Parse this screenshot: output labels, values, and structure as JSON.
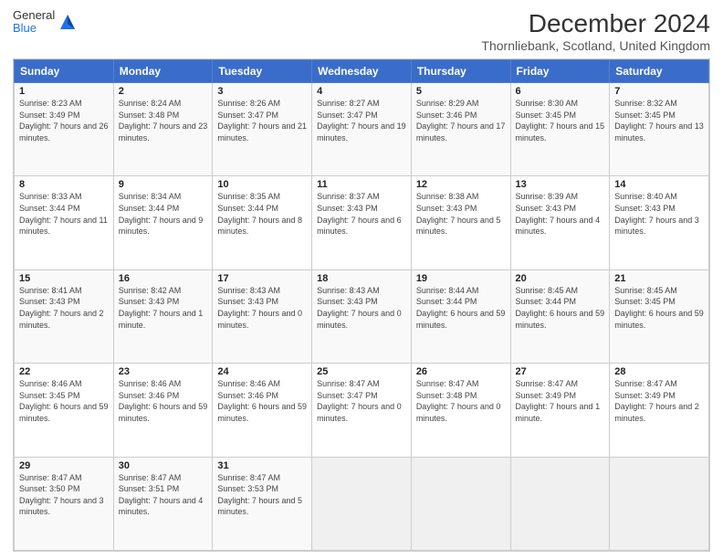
{
  "header": {
    "logo_general": "General",
    "logo_blue": "Blue",
    "title": "December 2024",
    "location": "Thornliebank, Scotland, United Kingdom"
  },
  "weekdays": [
    "Sunday",
    "Monday",
    "Tuesday",
    "Wednesday",
    "Thursday",
    "Friday",
    "Saturday"
  ],
  "weeks": [
    [
      {
        "day": "1",
        "sunrise": "Sunrise: 8:23 AM",
        "sunset": "Sunset: 3:49 PM",
        "daylight": "Daylight: 7 hours and 26 minutes."
      },
      {
        "day": "2",
        "sunrise": "Sunrise: 8:24 AM",
        "sunset": "Sunset: 3:48 PM",
        "daylight": "Daylight: 7 hours and 23 minutes."
      },
      {
        "day": "3",
        "sunrise": "Sunrise: 8:26 AM",
        "sunset": "Sunset: 3:47 PM",
        "daylight": "Daylight: 7 hours and 21 minutes."
      },
      {
        "day": "4",
        "sunrise": "Sunrise: 8:27 AM",
        "sunset": "Sunset: 3:47 PM",
        "daylight": "Daylight: 7 hours and 19 minutes."
      },
      {
        "day": "5",
        "sunrise": "Sunrise: 8:29 AM",
        "sunset": "Sunset: 3:46 PM",
        "daylight": "Daylight: 7 hours and 17 minutes."
      },
      {
        "day": "6",
        "sunrise": "Sunrise: 8:30 AM",
        "sunset": "Sunset: 3:45 PM",
        "daylight": "Daylight: 7 hours and 15 minutes."
      },
      {
        "day": "7",
        "sunrise": "Sunrise: 8:32 AM",
        "sunset": "Sunset: 3:45 PM",
        "daylight": "Daylight: 7 hours and 13 minutes."
      }
    ],
    [
      {
        "day": "8",
        "sunrise": "Sunrise: 8:33 AM",
        "sunset": "Sunset: 3:44 PM",
        "daylight": "Daylight: 7 hours and 11 minutes."
      },
      {
        "day": "9",
        "sunrise": "Sunrise: 8:34 AM",
        "sunset": "Sunset: 3:44 PM",
        "daylight": "Daylight: 7 hours and 9 minutes."
      },
      {
        "day": "10",
        "sunrise": "Sunrise: 8:35 AM",
        "sunset": "Sunset: 3:44 PM",
        "daylight": "Daylight: 7 hours and 8 minutes."
      },
      {
        "day": "11",
        "sunrise": "Sunrise: 8:37 AM",
        "sunset": "Sunset: 3:43 PM",
        "daylight": "Daylight: 7 hours and 6 minutes."
      },
      {
        "day": "12",
        "sunrise": "Sunrise: 8:38 AM",
        "sunset": "Sunset: 3:43 PM",
        "daylight": "Daylight: 7 hours and 5 minutes."
      },
      {
        "day": "13",
        "sunrise": "Sunrise: 8:39 AM",
        "sunset": "Sunset: 3:43 PM",
        "daylight": "Daylight: 7 hours and 4 minutes."
      },
      {
        "day": "14",
        "sunrise": "Sunrise: 8:40 AM",
        "sunset": "Sunset: 3:43 PM",
        "daylight": "Daylight: 7 hours and 3 minutes."
      }
    ],
    [
      {
        "day": "15",
        "sunrise": "Sunrise: 8:41 AM",
        "sunset": "Sunset: 3:43 PM",
        "daylight": "Daylight: 7 hours and 2 minutes."
      },
      {
        "day": "16",
        "sunrise": "Sunrise: 8:42 AM",
        "sunset": "Sunset: 3:43 PM",
        "daylight": "Daylight: 7 hours and 1 minute."
      },
      {
        "day": "17",
        "sunrise": "Sunrise: 8:43 AM",
        "sunset": "Sunset: 3:43 PM",
        "daylight": "Daylight: 7 hours and 0 minutes."
      },
      {
        "day": "18",
        "sunrise": "Sunrise: 8:43 AM",
        "sunset": "Sunset: 3:43 PM",
        "daylight": "Daylight: 7 hours and 0 minutes."
      },
      {
        "day": "19",
        "sunrise": "Sunrise: 8:44 AM",
        "sunset": "Sunset: 3:44 PM",
        "daylight": "Daylight: 6 hours and 59 minutes."
      },
      {
        "day": "20",
        "sunrise": "Sunrise: 8:45 AM",
        "sunset": "Sunset: 3:44 PM",
        "daylight": "Daylight: 6 hours and 59 minutes."
      },
      {
        "day": "21",
        "sunrise": "Sunrise: 8:45 AM",
        "sunset": "Sunset: 3:45 PM",
        "daylight": "Daylight: 6 hours and 59 minutes."
      }
    ],
    [
      {
        "day": "22",
        "sunrise": "Sunrise: 8:46 AM",
        "sunset": "Sunset: 3:45 PM",
        "daylight": "Daylight: 6 hours and 59 minutes."
      },
      {
        "day": "23",
        "sunrise": "Sunrise: 8:46 AM",
        "sunset": "Sunset: 3:46 PM",
        "daylight": "Daylight: 6 hours and 59 minutes."
      },
      {
        "day": "24",
        "sunrise": "Sunrise: 8:46 AM",
        "sunset": "Sunset: 3:46 PM",
        "daylight": "Daylight: 6 hours and 59 minutes."
      },
      {
        "day": "25",
        "sunrise": "Sunrise: 8:47 AM",
        "sunset": "Sunset: 3:47 PM",
        "daylight": "Daylight: 7 hours and 0 minutes."
      },
      {
        "day": "26",
        "sunrise": "Sunrise: 8:47 AM",
        "sunset": "Sunset: 3:48 PM",
        "daylight": "Daylight: 7 hours and 0 minutes."
      },
      {
        "day": "27",
        "sunrise": "Sunrise: 8:47 AM",
        "sunset": "Sunset: 3:49 PM",
        "daylight": "Daylight: 7 hours and 1 minute."
      },
      {
        "day": "28",
        "sunrise": "Sunrise: 8:47 AM",
        "sunset": "Sunset: 3:49 PM",
        "daylight": "Daylight: 7 hours and 2 minutes."
      }
    ],
    [
      {
        "day": "29",
        "sunrise": "Sunrise: 8:47 AM",
        "sunset": "Sunset: 3:50 PM",
        "daylight": "Daylight: 7 hours and 3 minutes."
      },
      {
        "day": "30",
        "sunrise": "Sunrise: 8:47 AM",
        "sunset": "Sunset: 3:51 PM",
        "daylight": "Daylight: 7 hours and 4 minutes."
      },
      {
        "day": "31",
        "sunrise": "Sunrise: 8:47 AM",
        "sunset": "Sunset: 3:53 PM",
        "daylight": "Daylight: 7 hours and 5 minutes."
      },
      null,
      null,
      null,
      null
    ]
  ]
}
